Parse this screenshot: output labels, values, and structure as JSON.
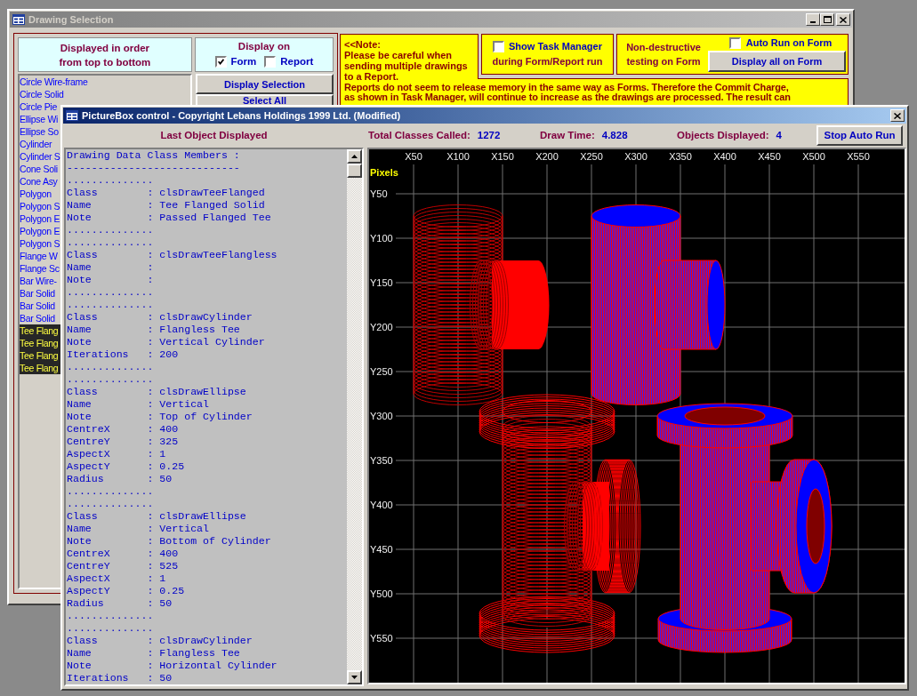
{
  "selection_window": {
    "title": "Drawing Selection",
    "active": false,
    "order_header": [
      "Displayed in order",
      "from top to bottom"
    ],
    "display_on": {
      "label": "Display on",
      "options": [
        {
          "label": "Form",
          "checked": true
        },
        {
          "label": "Report",
          "checked": false
        }
      ]
    },
    "drawings": [
      {
        "label": "Circle Wire-frame",
        "selected": false
      },
      {
        "label": "Circle Solid",
        "selected": false
      },
      {
        "label": "Circle Pie",
        "selected": false
      },
      {
        "label": "Ellipse Wi",
        "selected": false
      },
      {
        "label": "Ellipse So",
        "selected": false
      },
      {
        "label": "Cylinder",
        "selected": false
      },
      {
        "label": "Cylinder S",
        "selected": false
      },
      {
        "label": "Cone Soli",
        "selected": false
      },
      {
        "label": "Cone Asy",
        "selected": false
      },
      {
        "label": "Polygon",
        "selected": false
      },
      {
        "label": "Polygon S",
        "selected": false
      },
      {
        "label": "Polygon E",
        "selected": false
      },
      {
        "label": "Polygon E",
        "selected": false
      },
      {
        "label": "Polygon S",
        "selected": false
      },
      {
        "label": "Flange W",
        "selected": false
      },
      {
        "label": "Flange Sc",
        "selected": false
      },
      {
        "label": "Bar Wire-",
        "selected": false
      },
      {
        "label": "Bar Solid",
        "selected": false
      },
      {
        "label": "Bar Solid",
        "selected": false
      },
      {
        "label": "Bar Solid",
        "selected": false
      },
      {
        "label": "Tee Flang",
        "selected": true
      },
      {
        "label": "Tee Flang",
        "selected": true
      },
      {
        "label": "Tee Flang",
        "selected": true
      },
      {
        "label": "Tee Flang",
        "selected": true
      }
    ],
    "buttons": [
      "Display Selection",
      "Select All"
    ],
    "note": {
      "intro": [
        "<<Note:",
        "Please be careful when",
        "sending multiple drawings",
        "to a Report."
      ],
      "detail": [
        "Reports do not seem to release memory in the same way as Forms. Therefore the Commit Charge,",
        "as shown in Task Manager, will continue to increase as the drawings are processed. The result can"
      ]
    },
    "task_manager": {
      "label": "Show Task Manager",
      "checked": false,
      "caption": "during Form/Report run"
    },
    "testing": {
      "caption": [
        "Non-destructive",
        "testing on Form"
      ],
      "auto_run": {
        "label": "Auto Run on Form",
        "checked": false
      },
      "button": "Display all on Form"
    }
  },
  "picture_window": {
    "title": "PictureBox control - Copyright Lebans Holdings 1999 Ltd. (Modified)",
    "active": true,
    "panel_title": "Last Object Displayed",
    "stats": [
      {
        "label": "Total Classes Called:",
        "value": "1272"
      },
      {
        "label": "Draw Time:",
        "value": "4.828"
      },
      {
        "label": "Objects Displayed:",
        "value": "4"
      }
    ],
    "stop_button": "Stop Auto Run",
    "output_lines": [
      "Drawing Data Class Members :",
      "----------------------------",
      "..............",
      "Class        : clsDrawTeeFlanged",
      "Name         : Tee Flanged Solid",
      "Note         : Passed Flanged Tee",
      "..............",
      "..............",
      "Class        : clsDrawTeeFlangless",
      "Name         :",
      "Note         :",
      "..............",
      "..............",
      "Class        : clsDrawCylinder",
      "Name         : Flangless Tee",
      "Note         : Vertical Cylinder",
      "Iterations   : 200",
      "..............",
      "..............",
      "Class        : clsDrawEllipse",
      "Name         : Vertical",
      "Note         : Top of Cylinder",
      "CentreX      : 400",
      "CentreY      : 325",
      "AspectX      : 1",
      "AspectY      : 0.25",
      "Radius       : 50",
      "..............",
      "..............",
      "Class        : clsDrawEllipse",
      "Name         : Vertical",
      "Note         : Bottom of Cylinder",
      "CentreX      : 400",
      "CentreY      : 525",
      "AspectX      : 1",
      "AspectY      : 0.25",
      "Radius       : 50",
      "..............",
      "..............",
      "Class        : clsDrawCylinder",
      "Name         : Flangless Tee",
      "Note         : Horizontal Cylinder",
      "Iterations   : 50"
    ],
    "canvas": {
      "unit_label": "Pixels",
      "x_labels": [
        "X50",
        "X100",
        "X150",
        "X200",
        "X250",
        "X300",
        "X350",
        "X400",
        "X450",
        "X500",
        "X550"
      ],
      "y_labels": [
        "Y50",
        "Y100",
        "Y150",
        "Y200",
        "Y250",
        "Y300",
        "Y350",
        "Y400",
        "Y450",
        "Y500",
        "Y550"
      ]
    }
  }
}
